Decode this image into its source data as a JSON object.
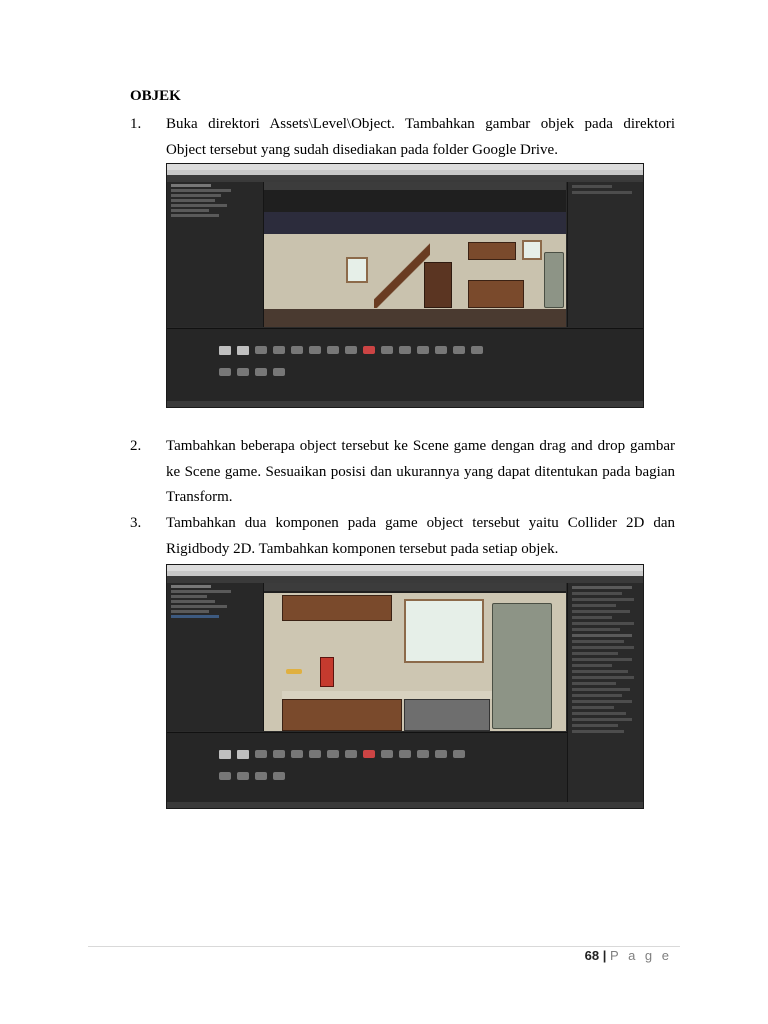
{
  "heading": "OBJEK",
  "steps": [
    {
      "num": "1.",
      "lines": [
        "Buka direktori Assets\\Level\\Object. Tambahkan gambar objek pada direktori",
        "Object tersebut yang sudah disediakan pada folder Google Drive."
      ]
    },
    {
      "num": "2.",
      "lines": [
        "Tambahkan beberapa object tersebut ke Scene game dengan drag and drop gambar",
        "ke Scene game. Sesuaikan posisi dan ukurannya yang dapat ditentukan pada bagian",
        "Transform."
      ]
    },
    {
      "num": "3.",
      "lines": [
        "Tambahkan dua komponen pada game object tersebut yaitu Collider 2D dan",
        "Rigidbody 2D. Tambahkan komponen tersebut pada setiap objek."
      ]
    }
  ],
  "footer": {
    "page_number": "68",
    "separator": "|",
    "page_word": "P a g e"
  }
}
